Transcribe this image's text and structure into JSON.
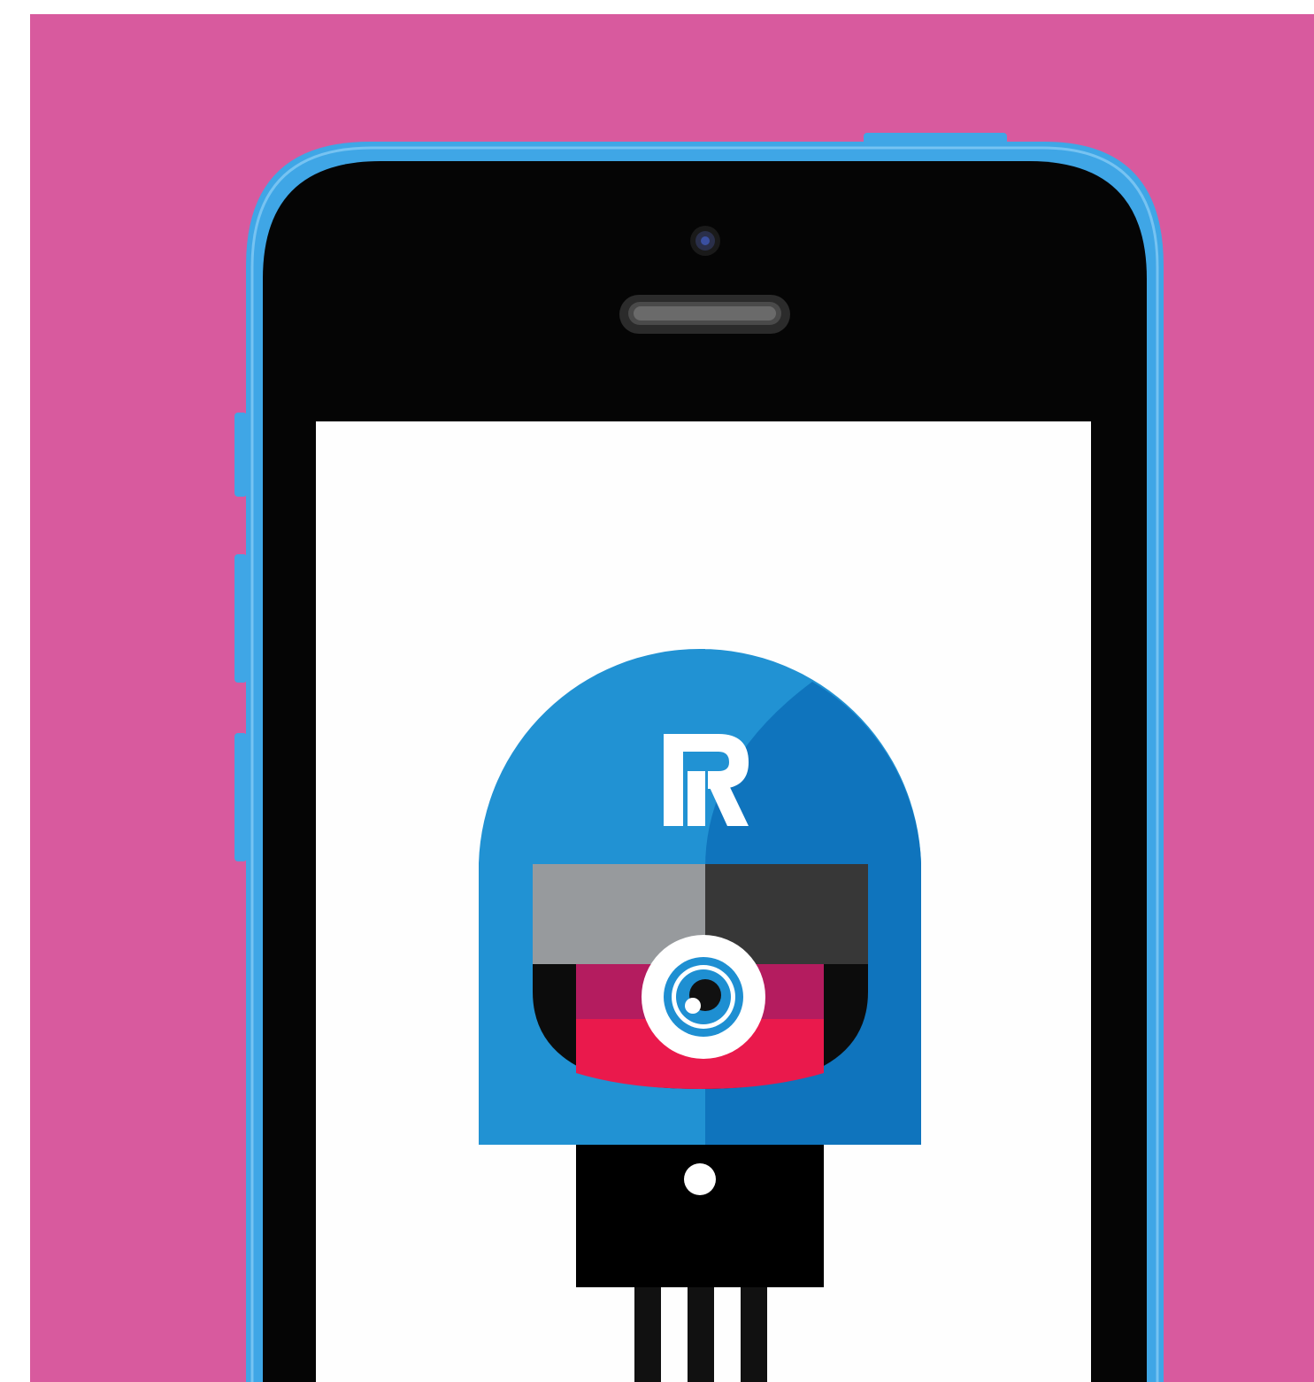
{
  "scene": {
    "description_label": "",
    "background_color": "#d85a9e",
    "phone": {
      "shell_color": "#3fa6e6",
      "bezel_color": "#050505",
      "screen_color": "#fefefe",
      "icons": [
        "front-camera-icon",
        "earpiece-speaker-icon",
        "volume-button-icon",
        "mute-switch-icon",
        "power-button-icon"
      ]
    },
    "mascot": {
      "letter": "R",
      "helmet_left_color": "#2192d3",
      "helmet_right_color": "#0f74bd",
      "visor_left_color": "#979a9d",
      "visor_right_color": "#373737",
      "mouth_magenta_color": "#b41c5f",
      "mouth_red_color": "#ea194c",
      "eye_iris_color": "#1e8fd2",
      "neck_color": "#000000",
      "cable_color": "#111111"
    }
  }
}
